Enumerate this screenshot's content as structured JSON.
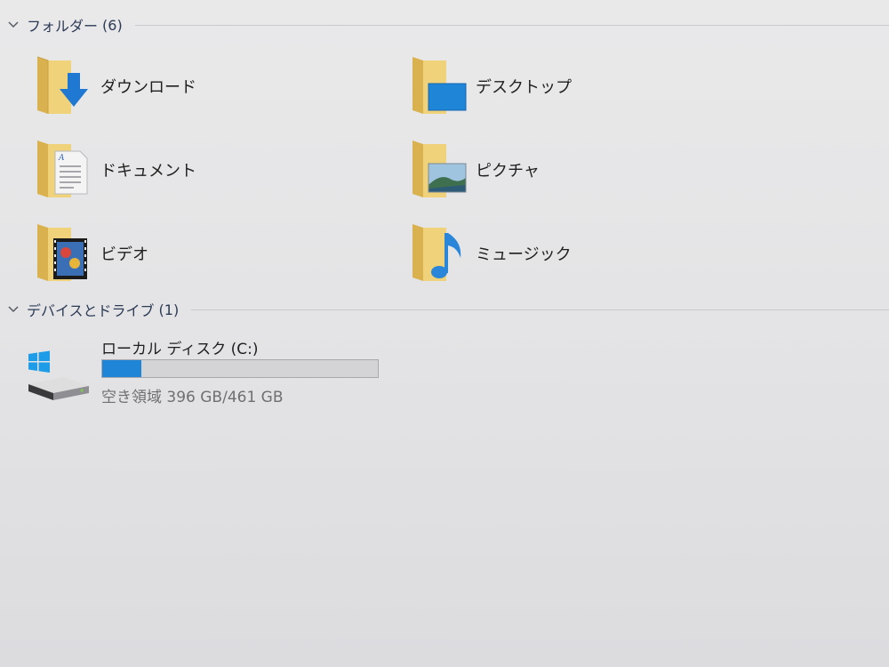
{
  "sections": {
    "folders": {
      "title": "フォルダー",
      "count": "(6)"
    },
    "devices": {
      "title": "デバイスとドライブ",
      "count": "(1)"
    }
  },
  "folders": [
    {
      "label": "ダウンロード",
      "icon": "download-folder-icon"
    },
    {
      "label": "デスクトップ",
      "icon": "desktop-folder-icon"
    },
    {
      "label": "ドキュメント",
      "icon": "documents-folder-icon"
    },
    {
      "label": "ピクチャ",
      "icon": "pictures-folder-icon"
    },
    {
      "label": "ビデオ",
      "icon": "videos-folder-icon"
    },
    {
      "label": "ミュージック",
      "icon": "music-folder-icon"
    }
  ],
  "drive": {
    "name": "ローカル ディスク (C:)",
    "free_text": "空き領域 396 GB/461 GB",
    "used_fraction": 0.141,
    "icon": "hard-drive-icon"
  },
  "colors": {
    "folder_yellow": "#e8c86a",
    "accent_blue": "#1f86d7",
    "header_text": "#2b3a55"
  }
}
